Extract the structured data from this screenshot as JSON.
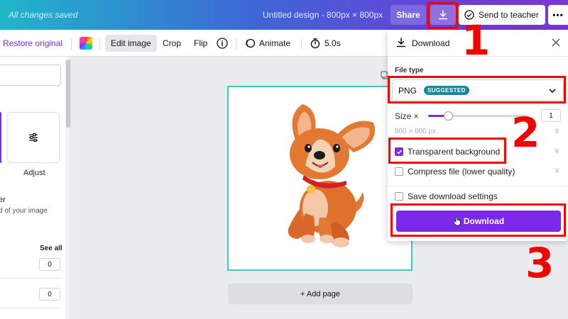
{
  "topbar": {
    "status": "All changes saved",
    "design_title": "Untitled design - 800px × 800px",
    "share_label": "Share",
    "download_icon": "download-icon",
    "send_to_teacher_label": "Send to teacher",
    "more_label": "•••"
  },
  "toolbar": {
    "restore_label": "Restore original",
    "edit_image_label": "Edit image",
    "crop_label": "Crop",
    "flip_label": "Flip",
    "info_symbol": "i",
    "animate_label": "Animate",
    "duration_label": "5.0s"
  },
  "left_panel": {
    "adjust_label": "Adjust",
    "partial_heading": "er",
    "partial_desc": "d of your image",
    "see_all_label": "See all",
    "value_1": "0",
    "value_2": "0"
  },
  "canvas": {
    "add_page_label": "+ Add page"
  },
  "download_panel": {
    "title": "Download",
    "file_type_label": "File type",
    "file_type_value": "PNG",
    "suggested_badge": "SUGGESTED",
    "size_label": "Size ×",
    "size_value": "1",
    "size_fraction": 0.2,
    "dimensions": "800 × 800 px",
    "transparent_label": "Transparent background",
    "transparent_checked": true,
    "compress_label": "Compress file (lower quality)",
    "compress_checked": false,
    "save_settings_label": "Save download settings",
    "save_settings_checked": false,
    "download_button_label": "Download"
  },
  "annotations": {
    "step_1": "1",
    "step_2": "2",
    "step_3": "3"
  },
  "colors": {
    "accent": "#7d2ae8",
    "annotation_red": "#f00400",
    "badge": "#1388a0",
    "page_border": "#40c7c5"
  }
}
